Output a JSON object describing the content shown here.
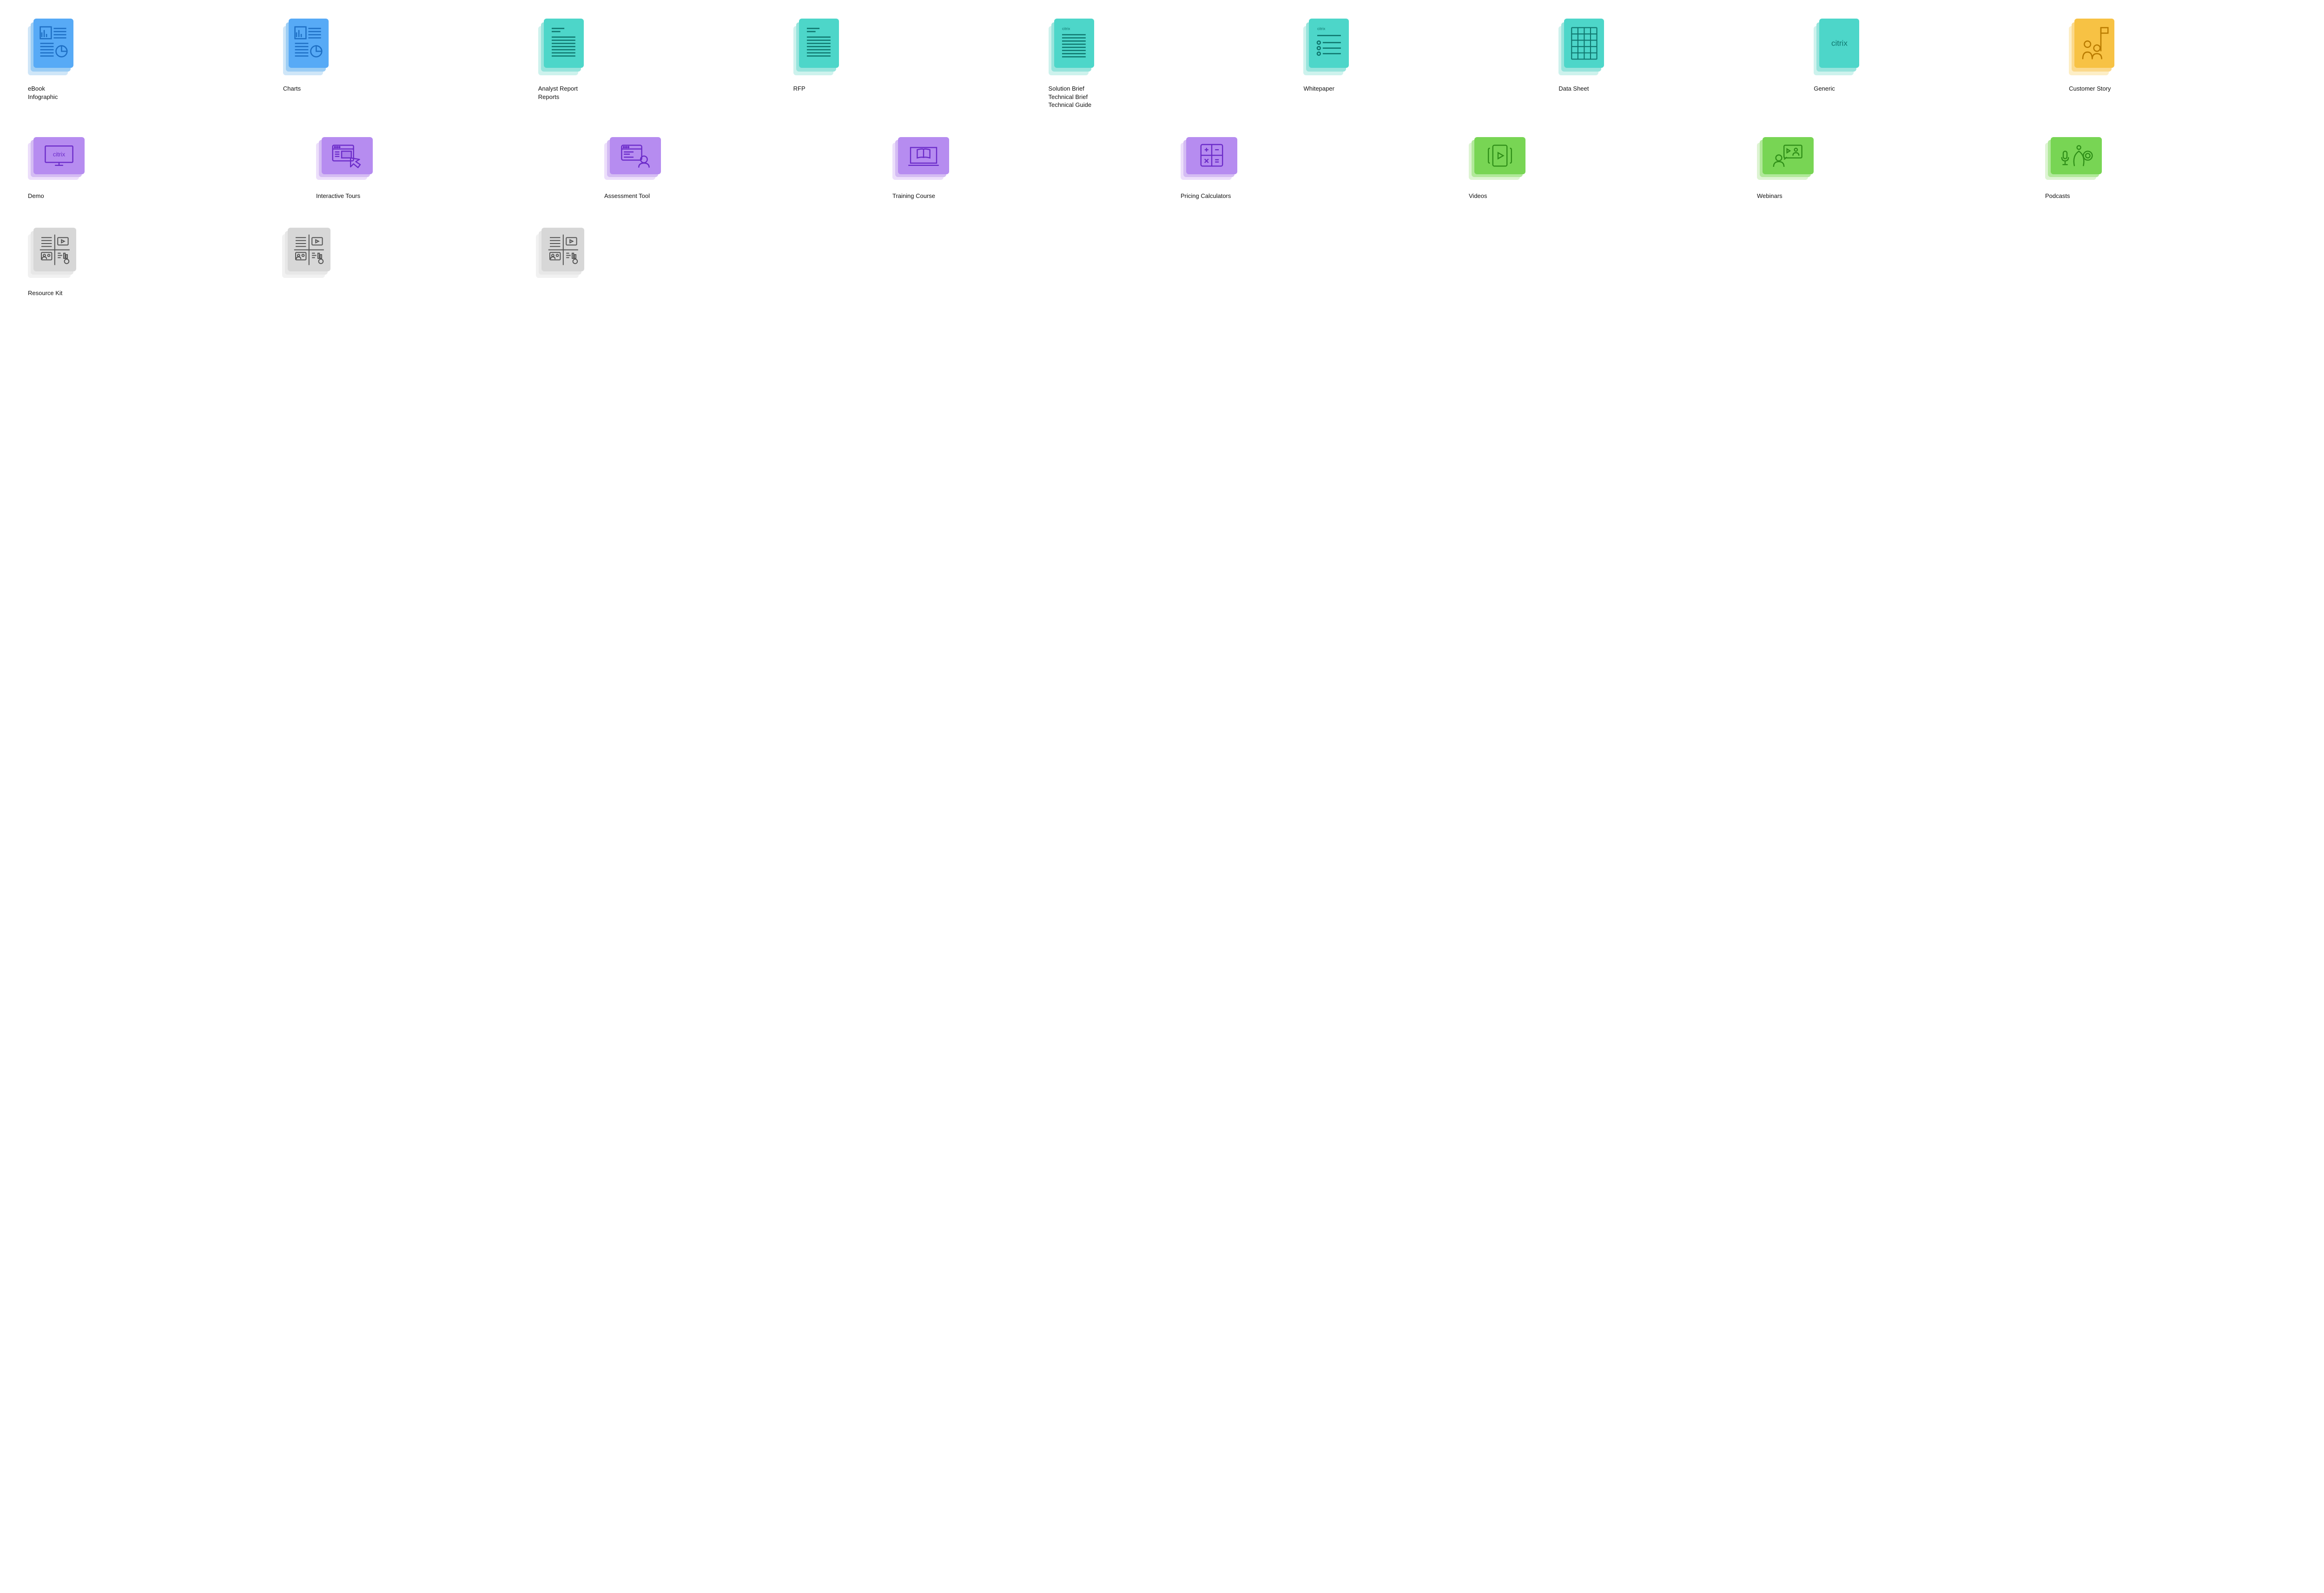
{
  "row1": [
    {
      "label": "eBook\nInfographic"
    },
    {
      "label": "Charts"
    },
    {
      "label": "Analyst Report\nReports"
    },
    {
      "label": "RFP"
    },
    {
      "label": "Solution Brief\nTechnical Brief\nTechnical Guide"
    },
    {
      "label": "Whitepaper"
    },
    {
      "label": "Data Sheet"
    },
    {
      "label": "Generic"
    },
    {
      "label": "Customer Story"
    }
  ],
  "row2": [
    {
      "label": "Demo"
    },
    {
      "label": "Interactive Tours"
    },
    {
      "label": "Assessment Tool"
    },
    {
      "label": "Training Course"
    },
    {
      "label": "Pricing Calculators"
    },
    {
      "label": "Videos"
    },
    {
      "label": "Webinars"
    },
    {
      "label": "Podcasts"
    }
  ],
  "row3": [
    {
      "label": "Resource Kit"
    },
    {
      "label": ""
    },
    {
      "label": ""
    }
  ],
  "brand": "citrix"
}
